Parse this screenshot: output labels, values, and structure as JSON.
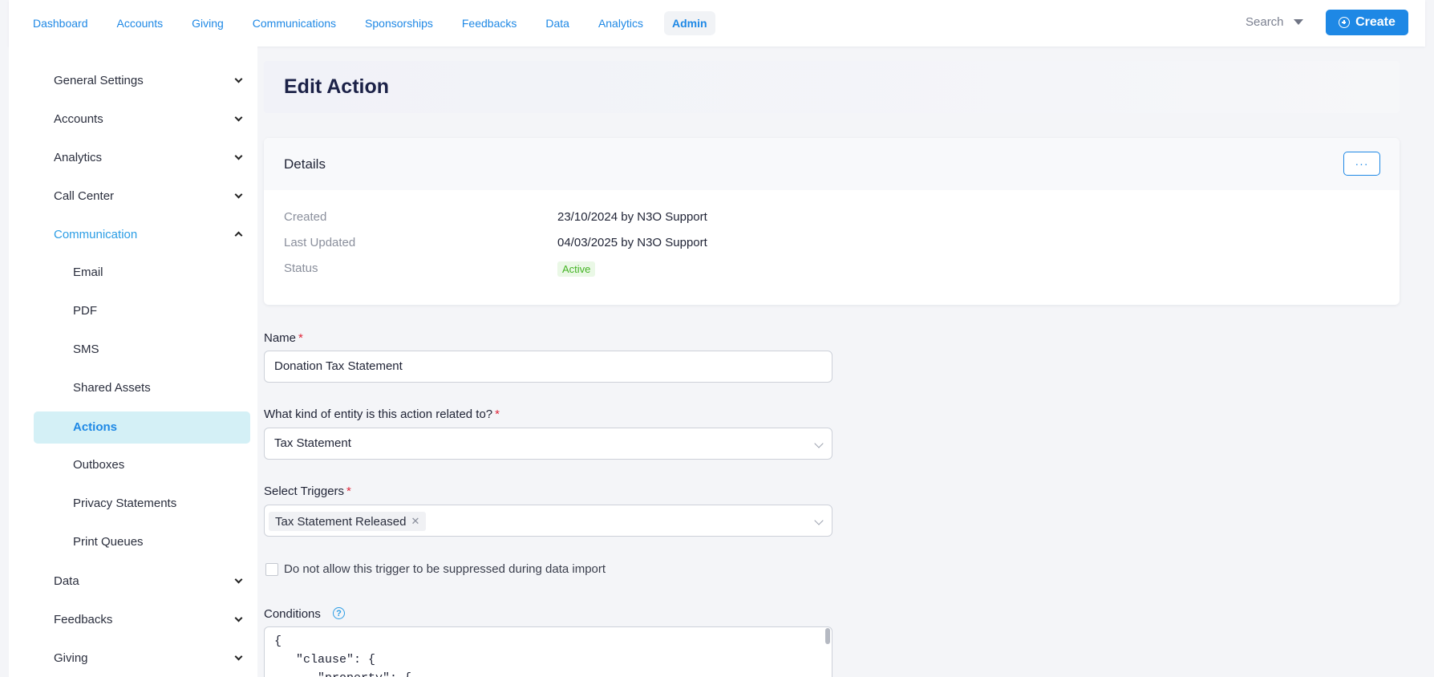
{
  "nav": {
    "items": [
      "Dashboard",
      "Accounts",
      "Giving",
      "Communications",
      "Sponsorships",
      "Feedbacks",
      "Data",
      "Analytics",
      "Admin"
    ],
    "active": "Admin",
    "search_label": "Search",
    "create_label": "Create"
  },
  "sidebar": {
    "groups": {
      "general_settings": "General Settings",
      "accounts": "Accounts",
      "analytics": "Analytics",
      "call_center": "Call Center",
      "communication": "Communication",
      "data": "Data",
      "feedbacks": "Feedbacks",
      "giving": "Giving"
    },
    "communication_items": {
      "email": "Email",
      "pdf": "PDF",
      "sms": "SMS",
      "shared_assets": "Shared Assets",
      "actions": "Actions",
      "outboxes": "Outboxes",
      "privacy_statements": "Privacy Statements",
      "print_queues": "Print Queues"
    }
  },
  "page": {
    "title": "Edit Action"
  },
  "details": {
    "title": "Details",
    "more_label": "···",
    "created_label": "Created",
    "created_value": "23/10/2024 by N3O Support",
    "updated_label": "Last Updated",
    "updated_value": "04/03/2025 by N3O Support",
    "status_label": "Status",
    "status_value": "Active",
    "status_color": "#44b324"
  },
  "form": {
    "name_label": "Name",
    "name_value": "Donation Tax Statement",
    "entity_label": "What kind of entity is this action related to?",
    "entity_value": "Tax Statement",
    "triggers_label": "Select Triggers",
    "trigger_tag": "Tax Statement Released",
    "suppress_label": "Do not allow this trigger to be suppressed during data import",
    "conditions_label": "Conditions",
    "conditions_code": "{\n   \"clause\": {\n      \"property\": {",
    "required_mark": "*"
  },
  "colors": {
    "accent": "#1e88e5",
    "active_bg": "#d4f0f6",
    "required": "#e0263a"
  }
}
